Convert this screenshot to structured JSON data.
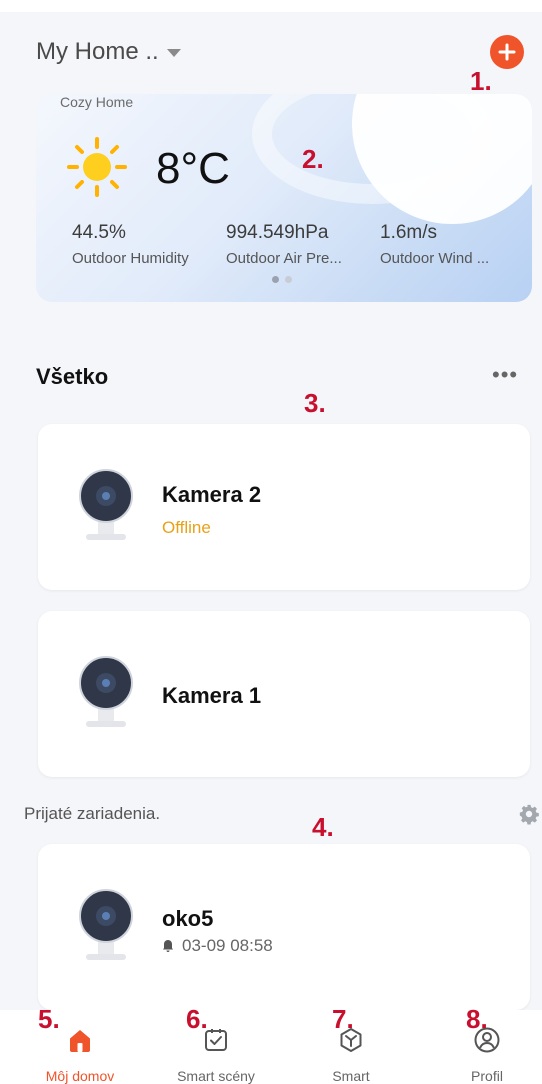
{
  "header": {
    "home_name": "My Home ..",
    "add_label": "+"
  },
  "annotations": [
    "1.",
    "2.",
    "3.",
    "4.",
    "5.",
    "6.",
    "7.",
    "8."
  ],
  "weather": {
    "label": "Cozy Home",
    "icon": "sun-icon",
    "temperature": "8°C",
    "stats": [
      {
        "value": "44.5%",
        "label": "Outdoor Humidity"
      },
      {
        "value": "994.549hPa",
        "label": "Outdoor Air Pre..."
      },
      {
        "value": "1.6m/s",
        "label": "Outdoor Wind ..."
      }
    ],
    "page_count": 2,
    "active_page": 1
  },
  "section": {
    "title": "Všetko",
    "more_label": "•••"
  },
  "devices": [
    {
      "name": "Kamera 2",
      "status": "Offline",
      "icon": "camera-icon"
    },
    {
      "name": "Kamera 1",
      "status": "",
      "icon": "camera-icon"
    }
  ],
  "received": {
    "title": "Prijaté zariadenia.",
    "settings_icon": "gear-icon",
    "devices": [
      {
        "name": "oko5",
        "time": "03-09 08:58",
        "icon": "camera-icon",
        "time_icon": "bell-icon"
      }
    ]
  },
  "tabs": [
    {
      "label": "Môj domov",
      "icon": "home-icon",
      "active": true
    },
    {
      "label": "Smart scény",
      "icon": "checkbox-icon",
      "active": false
    },
    {
      "label": "Smart",
      "icon": "hexagon-icon",
      "active": false
    },
    {
      "label": "Profil",
      "icon": "person-icon",
      "active": false
    }
  ],
  "colors": {
    "accent": "#f0542b",
    "offline": "#e8a219",
    "annotation": "#c8102e",
    "background": "#f5f6fa"
  }
}
